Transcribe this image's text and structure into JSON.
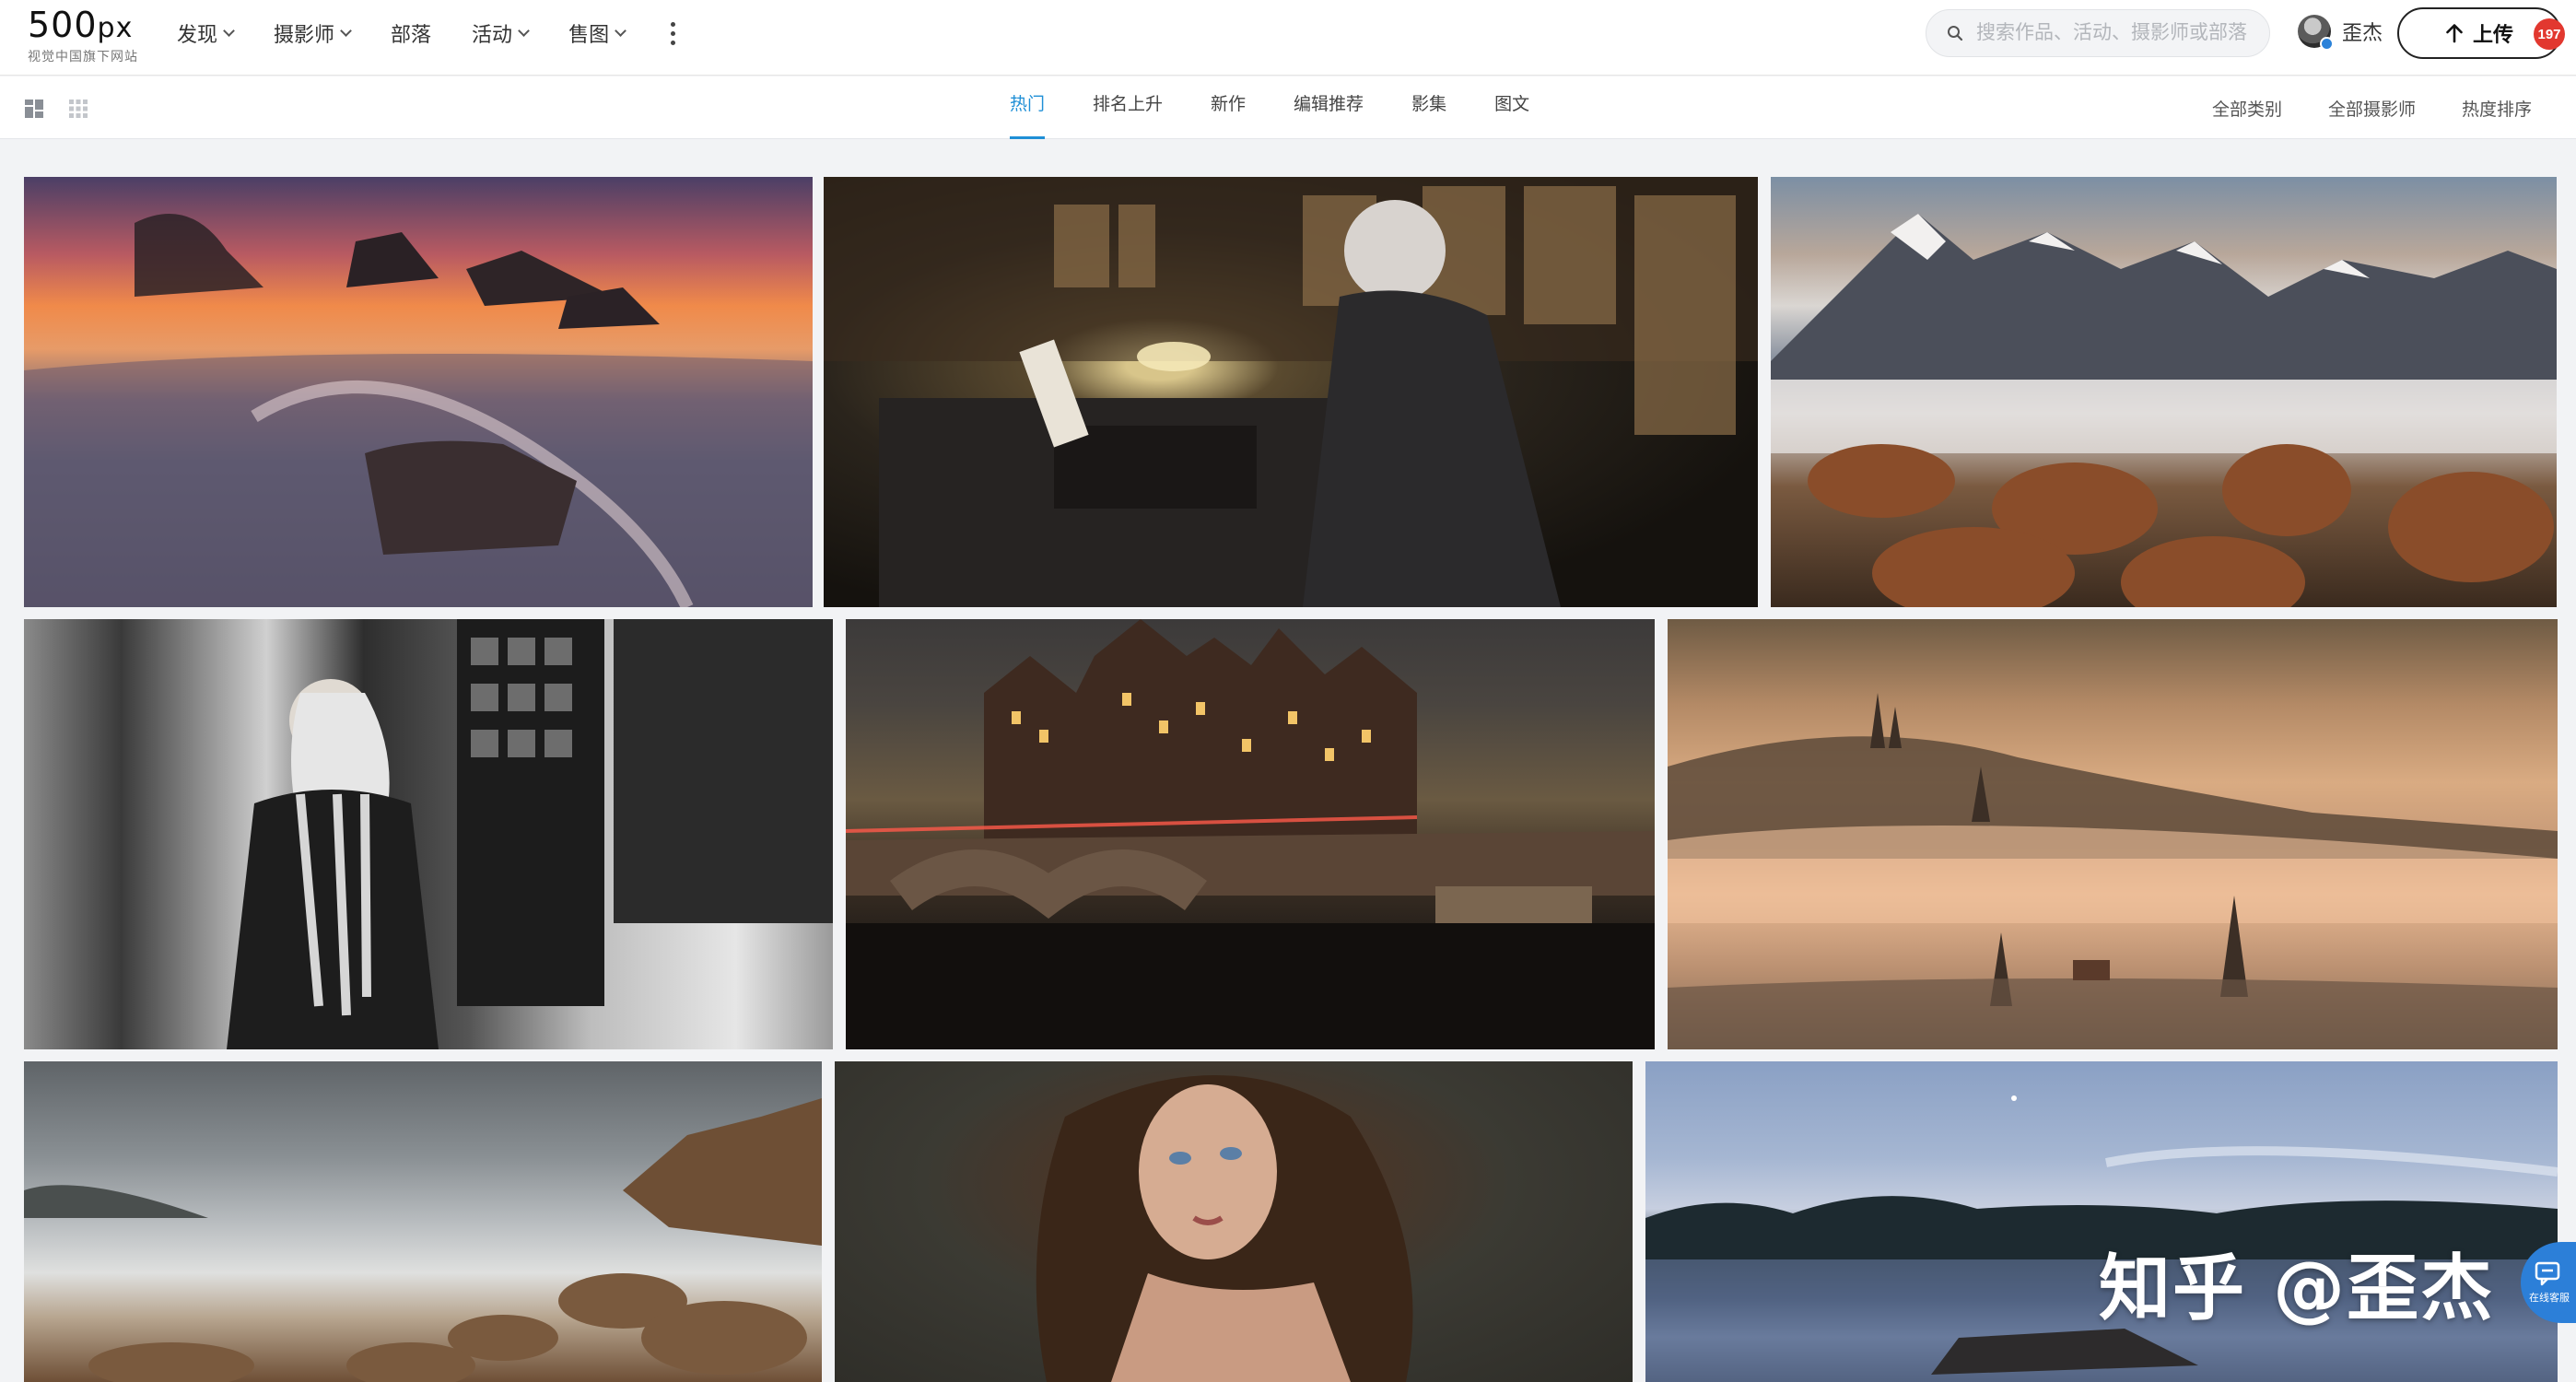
{
  "logo": {
    "main": "500",
    "main_suffix": "px",
    "sub": "视觉中国旗下网站"
  },
  "nav": {
    "items": [
      {
        "label": "发现",
        "has_dropdown": true
      },
      {
        "label": "摄影师",
        "has_dropdown": true
      },
      {
        "label": "部落",
        "has_dropdown": false
      },
      {
        "label": "活动",
        "has_dropdown": true
      },
      {
        "label": "售图",
        "has_dropdown": true
      }
    ],
    "more_icon": "vertical-ellipsis-icon"
  },
  "search": {
    "placeholder": "搜索作品、活动、摄影师或部落",
    "value": ""
  },
  "user": {
    "name": "歪杰",
    "verified": true
  },
  "upload": {
    "label": "上传",
    "icon": "arrow-up-icon"
  },
  "notifications": {
    "count": "197",
    "color": "#e2382f"
  },
  "subnav": {
    "view_modes": [
      "masonry-view-icon",
      "grid-view-icon"
    ],
    "tabs": [
      {
        "label": "热门",
        "active": true
      },
      {
        "label": "排名上升",
        "active": false
      },
      {
        "label": "新作",
        "active": false
      },
      {
        "label": "编辑推荐",
        "active": false
      },
      {
        "label": "影集",
        "active": false
      },
      {
        "label": "图文",
        "active": false
      }
    ],
    "filters": [
      "全部类别",
      "全部摄影师",
      "热度排序"
    ]
  },
  "photos": [
    {
      "subject": "seascape-sunset-rocks"
    },
    {
      "subject": "man-at-typewriter-library"
    },
    {
      "subject": "snowy-mountains-sunrise"
    },
    {
      "subject": "woman-street-portrait-bw"
    },
    {
      "subject": "amsterdam-canal-night"
    },
    {
      "subject": "foggy-hills-sunrise"
    },
    {
      "subject": "stormy-rocky-coast"
    },
    {
      "subject": "woman-portrait"
    },
    {
      "subject": "lake-dock-dusk"
    }
  ],
  "watermark": "知乎 @歪杰",
  "chat": {
    "label": "在线客服",
    "color": "#2c7fd8"
  },
  "accent_color": "#1f8fd6"
}
